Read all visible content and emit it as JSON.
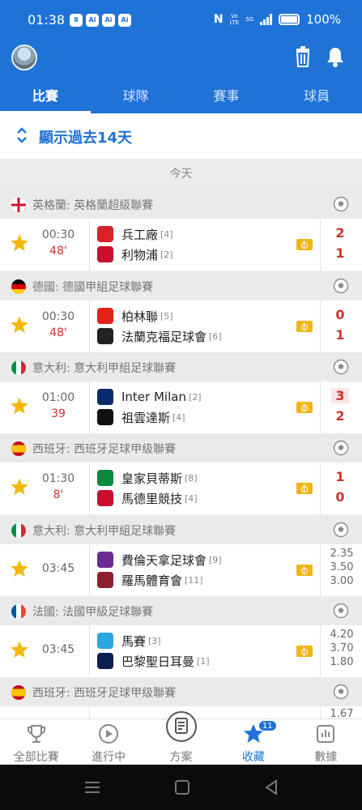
{
  "status_bar": {
    "time": "01:38",
    "battery": "100%",
    "net_top": "Vo",
    "net_bottom": "LTE",
    "gen": "5G",
    "app_icons": [
      "8",
      "Ai",
      "Ai",
      "Ai"
    ]
  },
  "tabs": [
    {
      "label": "比賽",
      "active": true
    },
    {
      "label": "球隊",
      "active": false
    },
    {
      "label": "賽事",
      "active": false
    },
    {
      "label": "球員",
      "active": false
    }
  ],
  "history_toggle": "顯示過去14天",
  "today_label": "今天",
  "matches": [
    {
      "league": "英格蘭: 英格蘭超級聯賽",
      "flag": "england",
      "time": "00:30",
      "minute": "48'",
      "home": {
        "name": "兵工廠",
        "rank": "[4]",
        "crest": "#d8222a"
      },
      "away": {
        "name": "利物浦",
        "rank": "[2]",
        "crest": "#c8102e"
      },
      "score_home": "2",
      "score_away": "1"
    },
    {
      "league": "德國: 德國甲組足球聯賽",
      "flag": "germany",
      "time": "00:30",
      "minute": "48'",
      "home": {
        "name": "柏林聯",
        "rank": "[5]",
        "crest": "#e2231a"
      },
      "away": {
        "name": "法蘭克福足球會",
        "rank": "[6]",
        "crest": "#222222"
      },
      "score_home": "0",
      "score_away": "1"
    },
    {
      "league": "意大利: 意大利甲組足球聯賽",
      "flag": "italy",
      "time": "01:00",
      "minute": "39",
      "home": {
        "name": "Inter Milan",
        "rank": "[2]",
        "crest": "#0a2c6d"
      },
      "away": {
        "name": "祖雲達斯",
        "rank": "[4]",
        "crest": "#111111"
      },
      "score_home": "3",
      "score_away": "2",
      "boxed": true
    },
    {
      "league": "西班牙: 西班牙足球甲级聯賽",
      "flag": "spain",
      "time": "01:30",
      "minute": "8'",
      "home": {
        "name": "皇家貝蒂斯",
        "rank": "[8]",
        "crest": "#0b8a3e"
      },
      "away": {
        "name": "馬德里競技",
        "rank": "[4]",
        "crest": "#c8102e"
      },
      "score_home": "1",
      "score_away": "0"
    },
    {
      "league": "意大利: 意大利甲組足球聯賽",
      "flag": "italy",
      "time": "03:45",
      "home": {
        "name": "費倫天拿足球會",
        "rank": "[9]",
        "crest": "#6a2c91"
      },
      "away": {
        "name": "羅馬體育會",
        "rank": "[11]",
        "crest": "#8e1f2f"
      },
      "odds": [
        "2.35",
        "3.50",
        "3.00"
      ]
    },
    {
      "league": "法國: 法國甲級足球聯賽",
      "flag": "france",
      "time": "03:45",
      "home": {
        "name": "馬賽",
        "rank": "[3]",
        "crest": "#2ba6de"
      },
      "away": {
        "name": "巴黎聖日耳曼",
        "rank": "[1]",
        "crest": "#0b1f4f"
      },
      "odds": [
        "4.20",
        "3.70",
        "1.80"
      ]
    },
    {
      "league": "西班牙: 西班牙足球甲级聯賽",
      "flag": "spain",
      "odds": [
        "1.67"
      ]
    }
  ],
  "bottom_nav": [
    {
      "label": "全部比賽",
      "icon": "trophy-icon",
      "active": false
    },
    {
      "label": "進行中",
      "icon": "play-icon",
      "active": false
    },
    {
      "label": "方案",
      "icon": "plan-icon",
      "active": false
    },
    {
      "label": "收藏",
      "icon": "star-icon",
      "active": true,
      "badge": "11"
    },
    {
      "label": "數據",
      "icon": "chart-icon",
      "active": false
    }
  ],
  "colors": {
    "primary": "#1f73d6",
    "score_red": "#d0312d",
    "star": "#f5b800"
  }
}
